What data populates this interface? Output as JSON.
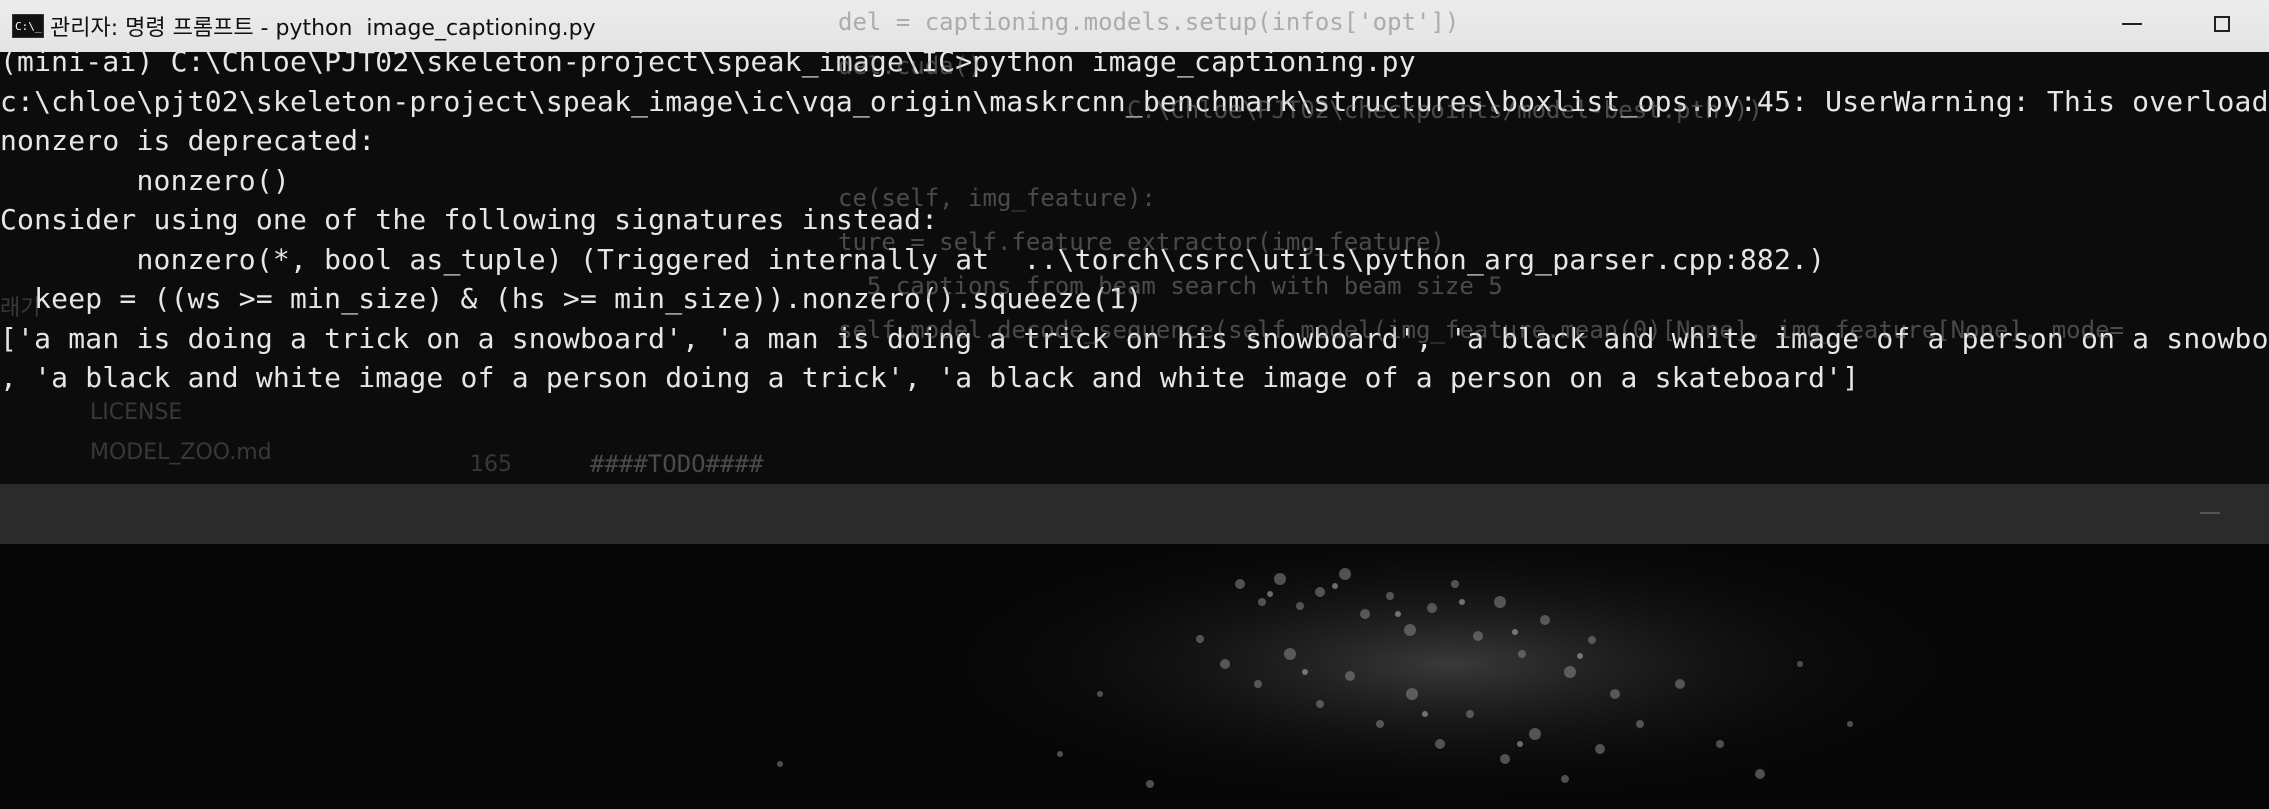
{
  "window": {
    "title": "관리자: 명령 프롬프트 - python  image_captioning.py",
    "icon_label": "C:\\_",
    "controls": [
      "minimize-icon",
      "maximize-icon"
    ]
  },
  "console": {
    "lines": [
      "(mini-ai) C:\\Chloe\\PJT02\\skeleton-project\\speak_image\\IC>python image_captioning.py",
      "c:\\chloe\\pjt02\\skeleton-project\\speak_image\\ic\\vqa_origin\\maskrcnn_benchmark\\structures\\boxlist_ops.py:45: UserWarning: This overload of",
      "nonzero is deprecated:",
      "        nonzero()",
      "Consider using one of the following signatures instead:",
      "        nonzero(*, bool as_tuple) (Triggered internally at  ..\\torch\\csrc\\utils\\python_arg_parser.cpp:882.)",
      "  keep = ((ws >= min_size) & (hs >= min_size)).nonzero().squeeze(1)",
      "['a man is doing a trick on a snowboard', 'a man is doing a trick on his snowboard', 'a black and white image of a person on a snowboard'",
      ", 'a black and white image of a person doing a trick', 'a black and white image of a person on a skateboard']"
    ]
  },
  "background_ide": {
    "title_code": "del = captioning.models.setup(infos['opt'])",
    "lines": [
      "del.cuda()",
      "                    C:\\Chloe\\PJT02\\checkpoints/model-best.pth'))",
      "",
      "ce(self, img_feature):",
      "ture = self.feature_extractor(img_feature)",
      "  5 captions from beam search with beam size 5",
      "self.model.decode_sequence(self.model(img_feature.mean(0)[None], img_feature[None], mode=",
      "",
      "####TODO####"
    ],
    "sidebar": [
      "LICENSE",
      "MODEL_ZOO.md"
    ],
    "gutter": "165",
    "misc_left": "래기"
  },
  "colors": {
    "titlebar_bg": "#e8e8e8",
    "console_bg": "#0c0c0c",
    "console_text": "#e6e6e6"
  }
}
